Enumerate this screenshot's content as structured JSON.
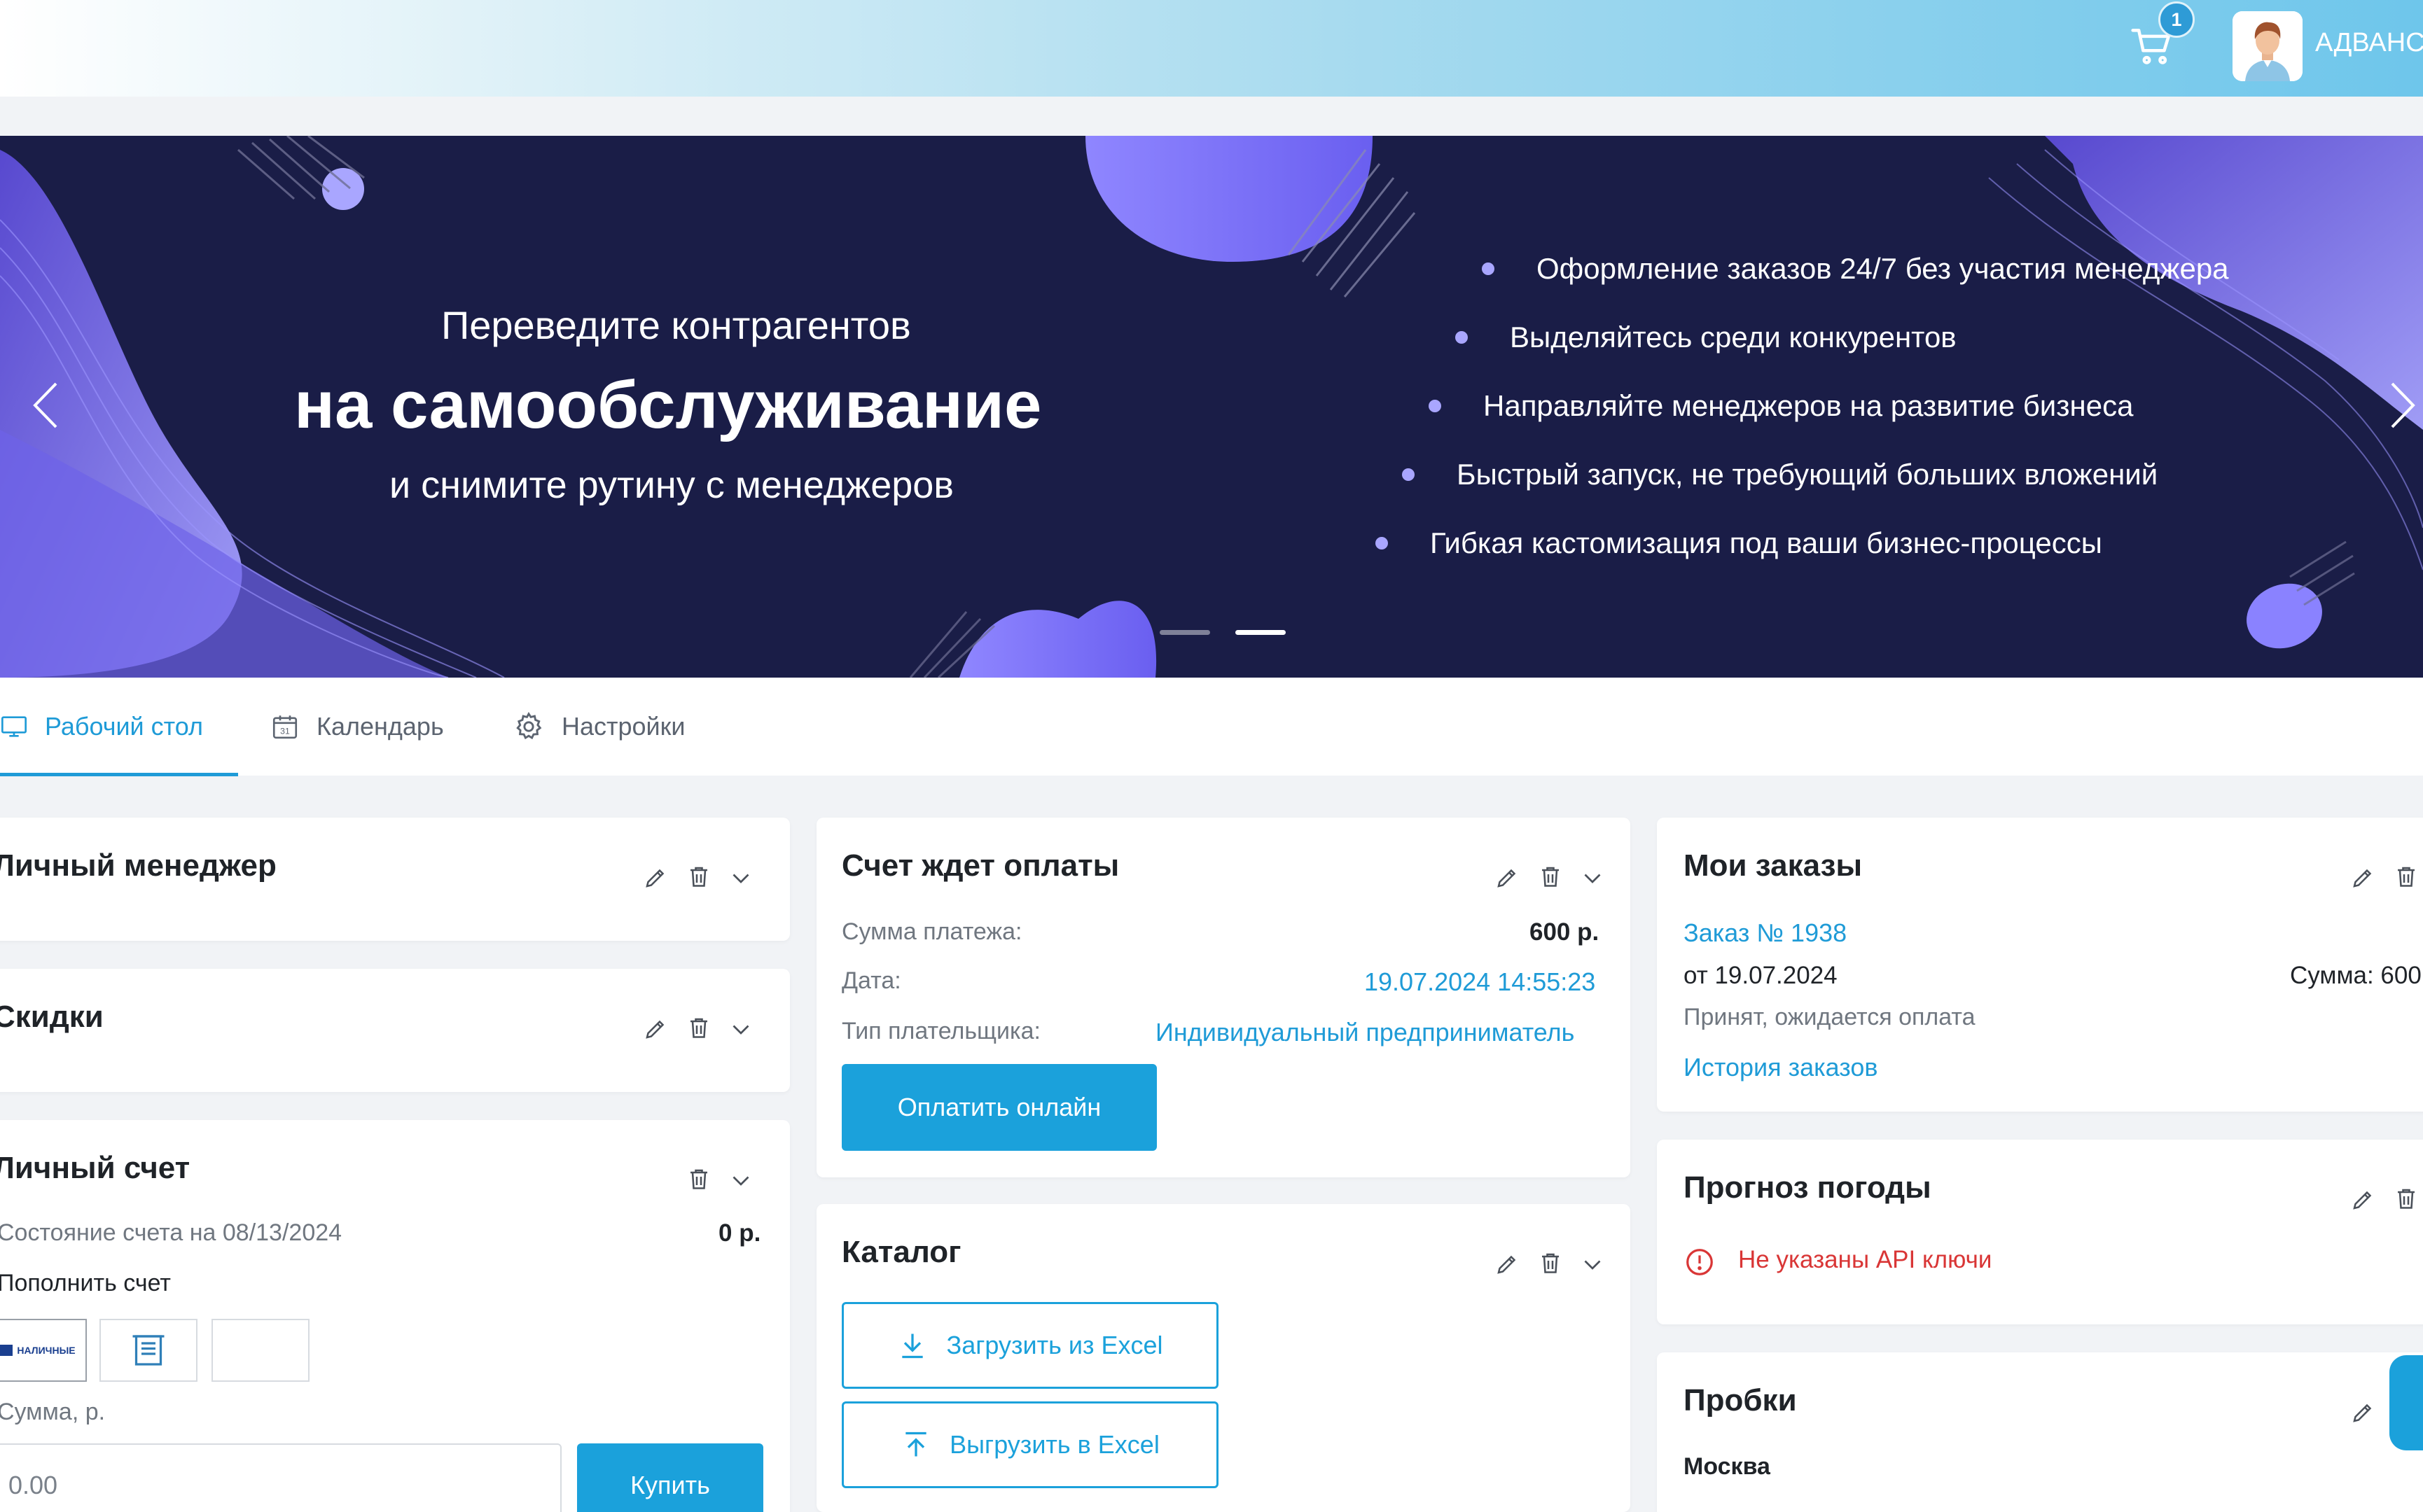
{
  "header": {
    "cart_count": "1",
    "user_name": "АДВАНС"
  },
  "banner": {
    "title_line1": "Переведите контрагентов",
    "title_line2": "на самообслуживание",
    "title_line3": "и снимите рутину с менеджеров",
    "bullets": [
      "Оформление заказов 24/7 без участия менеджера",
      "Выделяйтесь среди конкурентов",
      "Направляйте менеджеров на развитие бизнеса",
      "Быстрый запуск, не требующий больших вложений",
      "Гибкая кастомизация под ваши бизнес-процессы"
    ],
    "slide_count": 2,
    "active_slide": 2
  },
  "tabs": [
    {
      "label": "Рабочий стол",
      "icon": "monitor-icon",
      "active": true
    },
    {
      "label": "Календарь",
      "icon": "calendar-icon",
      "active": false
    },
    {
      "label": "Настройки",
      "icon": "gear-icon",
      "active": false
    }
  ],
  "widgets": {
    "manager": {
      "title": "Личный менеджер"
    },
    "discounts": {
      "title": "Скидки"
    },
    "account": {
      "title": "Личный счет",
      "status_label": "Состояние счета на 08/13/2024",
      "status_value": "0 р.",
      "topup_label": "Пополнить счет",
      "cash_option": "НАЛИЧНЫЕ",
      "amount_label": "Сумма, р.",
      "amount_placeholder": "0.00",
      "buy_label": "Купить"
    },
    "invoice": {
      "title": "Счет ждет оплаты",
      "sum_label": "Сумма платежа:",
      "sum_value": "600 р.",
      "date_label": "Дата:",
      "date_value": "19.07.2024 14:55:23",
      "payer_label": "Тип плательщика:",
      "payer_value": "Индивидуальный предприниматель",
      "pay_button": "Оплатить онлайн"
    },
    "catalog": {
      "title": "Каталог",
      "import_button": "Загрузить из Excel",
      "export_button": "Выгрузить в Excel"
    },
    "orders": {
      "title": "Мои заказы",
      "order_link": "Заказ № 1938",
      "order_date": "от 19.07.2024",
      "order_sum": "Сумма: 600",
      "order_status": "Принят, ожидается оплата",
      "history_link": "История заказов"
    },
    "weather": {
      "title": "Прогноз погоды",
      "error": "Не указаны API ключи"
    },
    "traffic": {
      "title": "Пробки",
      "city": "Москва"
    }
  },
  "colors": {
    "accent": "#1f9bd7",
    "banner_bg": "#1a1d47",
    "error": "#d93636"
  }
}
